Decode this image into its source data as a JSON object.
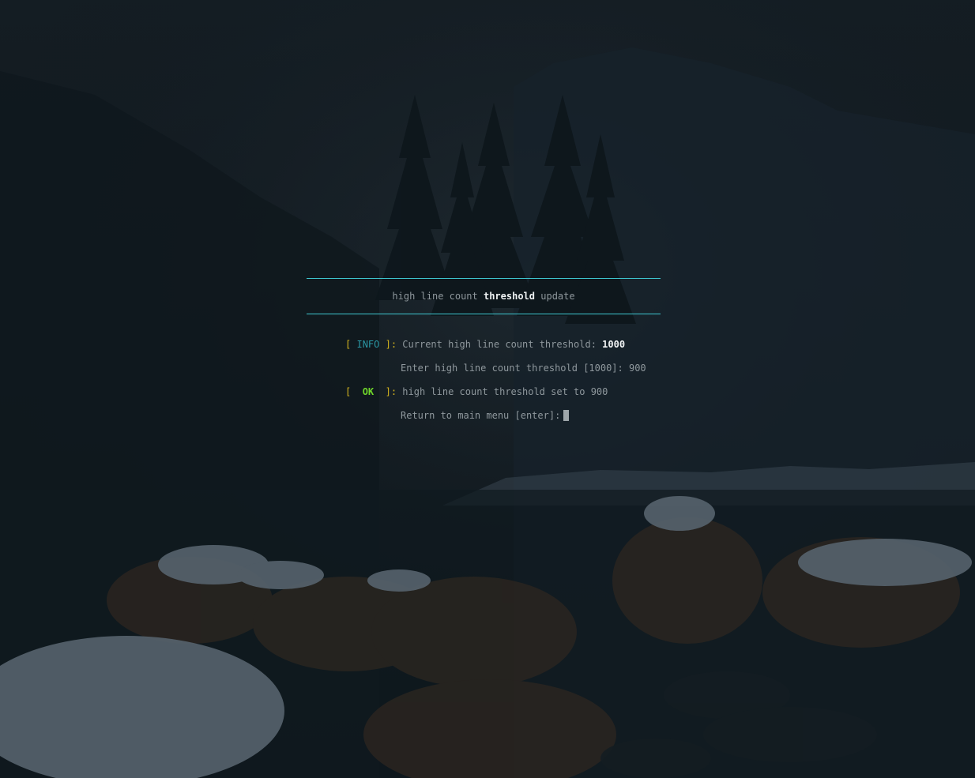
{
  "header": {
    "title_pre": "high line count ",
    "title_bold": "threshold",
    "title_post": " update"
  },
  "log": [
    {
      "bracket_open": "[",
      "tag": "INFO",
      "bracket_close": "]:",
      "text": "Current high line count threshold: ",
      "value": "1000"
    },
    {
      "prompt": "Enter high line count threshold [1000]: 900"
    },
    {
      "bracket_open": "[",
      "tag": "OK",
      "bracket_close": "]:",
      "text": "high line count threshold set to 900"
    },
    {
      "prompt": "Return to main menu [enter]:"
    }
  ],
  "colors": {
    "rule": "#3ec6cf",
    "bracket": "#d2b21e",
    "info_tag": "#2b98a5",
    "ok_tag": "#6fd62a",
    "text": "#8f989d",
    "highlight": "#f3f5f6"
  }
}
